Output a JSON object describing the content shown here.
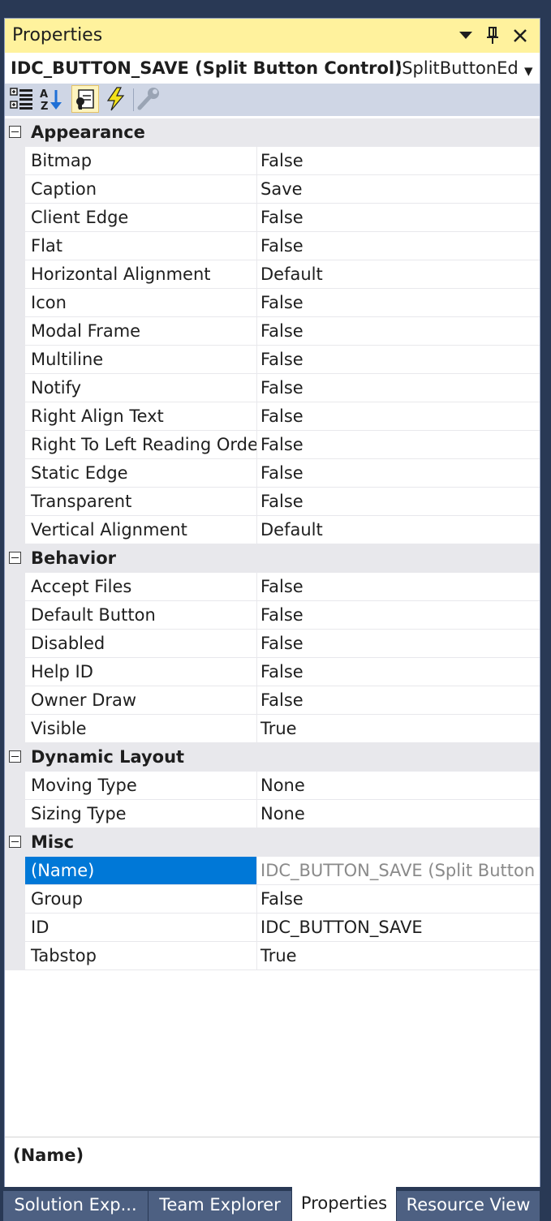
{
  "panel": {
    "title": "Properties",
    "object_name": "IDC_BUTTON_SAVE (Split Button Control)",
    "object_class": "ISplitButtonEd",
    "dropdown_glyph": "▾"
  },
  "toolbar": {
    "icons": [
      "categorized-icon",
      "alphabetical-icon",
      "properties-page-icon",
      "events-icon",
      "property-pages-wrench-icon"
    ]
  },
  "categories": {
    "appearance": {
      "label": "Appearance",
      "props": [
        {
          "name": "Bitmap",
          "value": "False"
        },
        {
          "name": "Caption",
          "value": "Save"
        },
        {
          "name": "Client Edge",
          "value": "False"
        },
        {
          "name": "Flat",
          "value": "False"
        },
        {
          "name": "Horizontal Alignment",
          "value": "Default"
        },
        {
          "name": "Icon",
          "value": "False"
        },
        {
          "name": "Modal Frame",
          "value": "False"
        },
        {
          "name": "Multiline",
          "value": "False"
        },
        {
          "name": "Notify",
          "value": "False"
        },
        {
          "name": "Right Align Text",
          "value": "False"
        },
        {
          "name": "Right To Left Reading Order",
          "value": "False"
        },
        {
          "name": "Static Edge",
          "value": "False"
        },
        {
          "name": "Transparent",
          "value": "False"
        },
        {
          "name": "Vertical Alignment",
          "value": "Default"
        }
      ]
    },
    "behavior": {
      "label": "Behavior",
      "props": [
        {
          "name": "Accept Files",
          "value": "False"
        },
        {
          "name": "Default Button",
          "value": "False"
        },
        {
          "name": "Disabled",
          "value": "False"
        },
        {
          "name": "Help ID",
          "value": "False"
        },
        {
          "name": "Owner Draw",
          "value": "False"
        },
        {
          "name": "Visible",
          "value": "True"
        }
      ]
    },
    "dynamic_layout": {
      "label": "Dynamic Layout",
      "props": [
        {
          "name": "Moving Type",
          "value": "None"
        },
        {
          "name": "Sizing Type",
          "value": "None"
        }
      ]
    },
    "misc": {
      "label": "Misc",
      "props": [
        {
          "name": "(Name)",
          "value": "IDC_BUTTON_SAVE (Split Button Control)"
        },
        {
          "name": "Group",
          "value": "False"
        },
        {
          "name": "ID",
          "value": "IDC_BUTTON_SAVE"
        },
        {
          "name": "Tabstop",
          "value": "True"
        }
      ]
    }
  },
  "description": {
    "title": "(Name)"
  },
  "tabs": [
    {
      "label": "Solution Exp..."
    },
    {
      "label": "Team Explorer"
    },
    {
      "label": "Properties"
    },
    {
      "label": "Resource View"
    }
  ],
  "colors": {
    "accent_title": "#fff29d",
    "selection": "#0078d7",
    "chrome": "#293955"
  }
}
